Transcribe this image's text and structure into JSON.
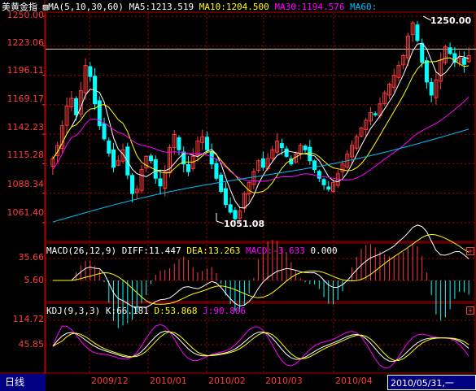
{
  "header": {
    "title": "美黄金指",
    "indicator": "MA(5,10,30,60)",
    "ma5": "MA5:1213.519",
    "ma10": "MA10:1204.500",
    "ma30": "MA30:1194.576",
    "ma60": "MA60:"
  },
  "macd_header": {
    "name": "MACD(26,12,9)",
    "diff": "DIFF:11.447",
    "dea": "DEA:13.263",
    "macd": "MACD:-3.633",
    "extra": "0.000"
  },
  "kdj_header": {
    "name": "KDJ(9,3,3)",
    "k": "K:66.181",
    "d": "D:53.868",
    "j": "J:90.806"
  },
  "price_axis": [
    "1250.00",
    "1223.06",
    "1196.11",
    "1169.17",
    "1142.23",
    "1115.28",
    "1088.34",
    "1061.40"
  ],
  "macd_axis": [
    "35.66",
    "5.60"
  ],
  "kdj_axis": [
    "114.72",
    "45.85"
  ],
  "date_axis": [
    "2009/12",
    "2010/01",
    "2010/02",
    "2010/03",
    "2010/04"
  ],
  "high_label": "1250.00",
  "low_label": "1051.08",
  "bottom": {
    "period_tab": "日线",
    "date_readout": "2010/05/31,一"
  },
  "colors": {
    "up": "#ff3b3b",
    "down": "#00ffff",
    "ma5": "#ffffff",
    "ma10": "#ffff00",
    "ma30": "#ff00ff",
    "ma60": "#00c0ff",
    "grid": "#b00000"
  },
  "chart_data": {
    "type": "candlestick",
    "period": "daily",
    "y_range": [
      1051.08,
      1250.0
    ],
    "high": 1250.0,
    "low": 1051.08,
    "close_series_approx": [
      1120,
      1132,
      1150,
      1168,
      1175,
      1160,
      1182,
      1205,
      1195,
      1170,
      1150,
      1138,
      1125,
      1112,
      1118,
      1128,
      1105,
      1088,
      1092,
      1110,
      1122,
      1118,
      1102,
      1095,
      1108,
      1130,
      1142,
      1128,
      1115,
      1108,
      1122,
      1136,
      1140,
      1128,
      1115,
      1102,
      1090,
      1078,
      1071,
      1065,
      1072,
      1088,
      1098,
      1108,
      1118,
      1112,
      1120,
      1128,
      1136,
      1130,
      1122,
      1115,
      1124,
      1132,
      1128,
      1118,
      1110,
      1102,
      1096,
      1092,
      1098,
      1106,
      1115,
      1124,
      1132,
      1140,
      1148,
      1155,
      1162,
      1160,
      1170,
      1180,
      1188,
      1196,
      1205,
      1214,
      1232,
      1244,
      1228,
      1208,
      1190,
      1178,
      1192,
      1210,
      1222,
      1216,
      1208,
      1212,
      1206,
      1214
    ]
  }
}
